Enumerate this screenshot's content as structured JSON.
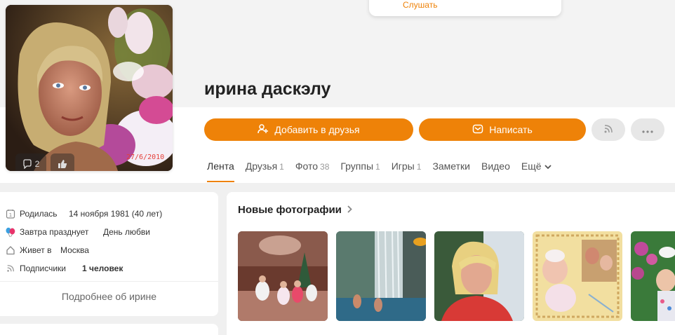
{
  "dropdown": {
    "listen_label": "Слушать"
  },
  "avatar": {
    "comments_count": "2",
    "date_stamp": "27/6/2010"
  },
  "profile": {
    "name": "ирина даскэлу"
  },
  "actions": {
    "add_friend_label": "Добавить в друзья",
    "write_label": "Написать",
    "subscribe_icon": "rss-icon",
    "more_icon": "ellipsis-icon"
  },
  "tabs": [
    {
      "label": "Лента",
      "count": ""
    },
    {
      "label": "Друзья",
      "count": "1"
    },
    {
      "label": "Фото",
      "count": "38"
    },
    {
      "label": "Группы",
      "count": "1"
    },
    {
      "label": "Игры",
      "count": "1"
    },
    {
      "label": "Заметки",
      "count": ""
    },
    {
      "label": "Видео",
      "count": ""
    },
    {
      "label": "Ещё",
      "count": ""
    }
  ],
  "info": {
    "born_label": "Родилась",
    "born_value": "14 ноября 1981 (40 лет)",
    "holiday_label": "Завтра празднует",
    "holiday_value": "День любви",
    "lives_label": "Живет в",
    "lives_value": "Москва",
    "subs_label": "Подписчики",
    "subs_value": "1 человек",
    "more_link": "Подробнее об ирине"
  },
  "photos": {
    "title": "Новые фотографии",
    "items": [
      "photo-1",
      "photo-2",
      "photo-3",
      "photo-4",
      "photo-5"
    ]
  },
  "colors": {
    "accent": "#ee8208",
    "page_bg": "#f0f0f0",
    "card_bg": "#ffffff"
  }
}
